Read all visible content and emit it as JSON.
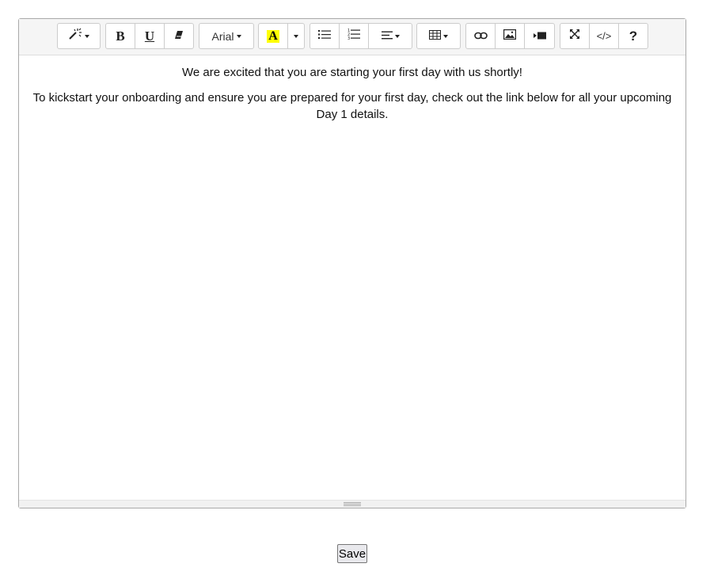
{
  "toolbar": {
    "font_name": "Arial",
    "bold_label": "B",
    "underline_label": "U",
    "highlight_label": "A",
    "code_label": "</>",
    "help_label": "?",
    "highlight_color": "#ffff00",
    "icons": [
      "magic-icon",
      "eraser-icon",
      "unordered-list-icon",
      "ordered-list-icon",
      "align-icon",
      "table-icon",
      "link-icon",
      "image-icon",
      "video-icon",
      "fullscreen-icon"
    ]
  },
  "content": {
    "paragraph_1": "We are excited that you are starting your first day with us shortly!",
    "paragraph_2": "To kickstart your onboarding and ensure you are prepared for your first day, check out the link below for all your upcoming Day 1 details."
  },
  "save_button": "Save"
}
